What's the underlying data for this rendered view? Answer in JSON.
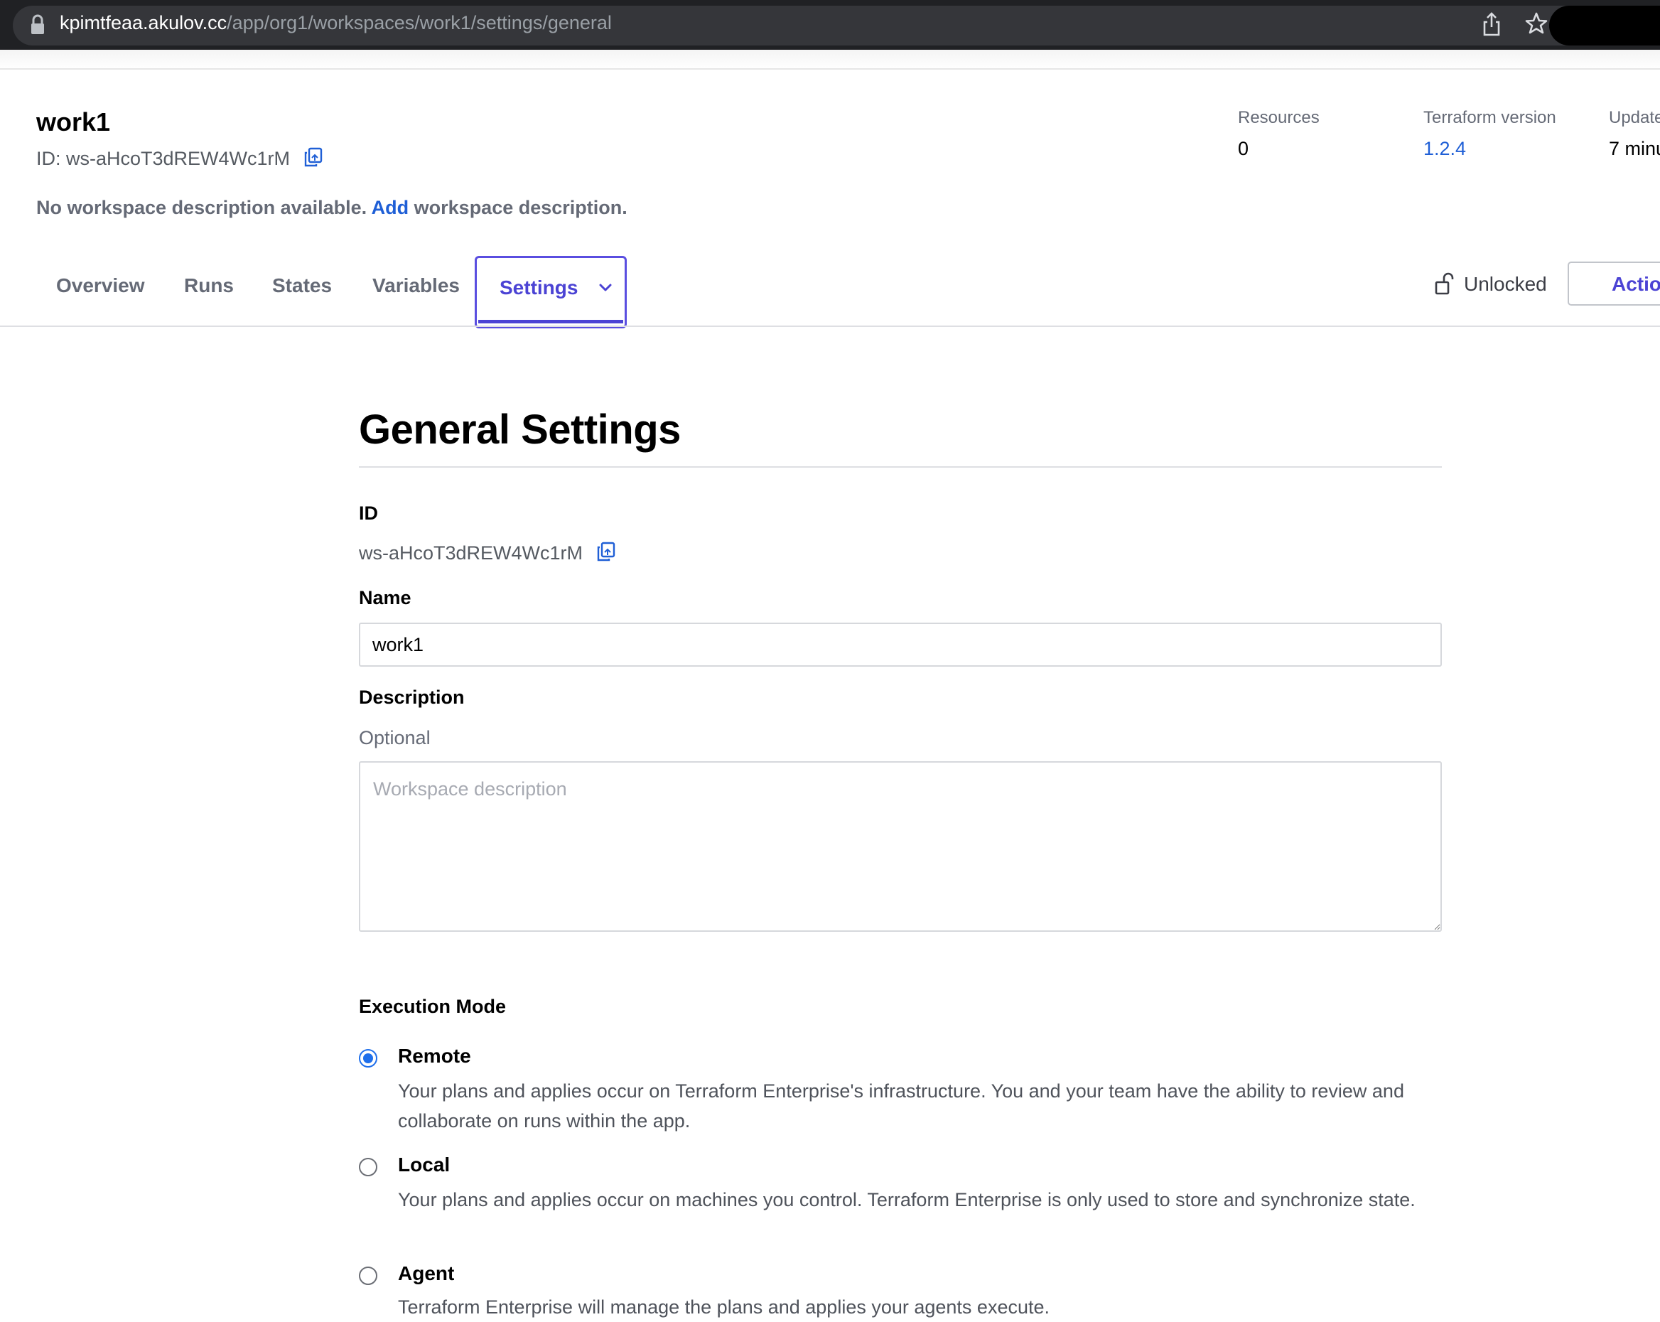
{
  "browser": {
    "url_host": "kpimtfeaa.akulov.cc",
    "url_path": "/app/org1/workspaces/work1/settings/general"
  },
  "workspace": {
    "name": "work1",
    "id_label": "ID: ws-aHcoT3dREW4Wc1rM",
    "desc_before": "No workspace description available. ",
    "desc_link": "Add",
    "desc_after": " workspace description.",
    "meta": {
      "resources_label": "Resources",
      "resources_value": "0",
      "tf_version_label": "Terraform version",
      "tf_version_value": "1.2.4",
      "updated_label": "Update",
      "updated_value": "7 minu"
    }
  },
  "tabs": {
    "overview": "Overview",
    "runs": "Runs",
    "states": "States",
    "variables": "Variables",
    "settings": "Settings"
  },
  "status": {
    "lock_label": "Unlocked",
    "actions_label": "Actio"
  },
  "settings": {
    "heading": "General Settings",
    "id_label": "ID",
    "id_value": "ws-aHcoT3dREW4Wc1rM",
    "name_label": "Name",
    "name_value": "work1",
    "description_label": "Description",
    "description_optional": "Optional",
    "description_placeholder": "Workspace description",
    "execution_mode_label": "Execution Mode",
    "modes": [
      {
        "title": "Remote",
        "description": "Your plans and applies occur on Terraform Enterprise's infrastructure. You and your team have the ability to review and collaborate on runs within the app.",
        "selected": true
      },
      {
        "title": "Local",
        "description": "Your plans and applies occur on machines you control. Terraform Enterprise is only used to store and synchronize state.",
        "selected": false
      },
      {
        "title": "Agent",
        "description": "Terraform Enterprise will manage the plans and applies your agents execute.",
        "selected": false
      }
    ]
  },
  "colors": {
    "link": "#1f5fd6",
    "accent": "#4b43d4",
    "radio_selected": "#1f6feb"
  },
  "icons": [
    "lock-icon",
    "share-icon",
    "star-icon",
    "copy-icon",
    "chevron-down-icon",
    "unlock-icon"
  ]
}
